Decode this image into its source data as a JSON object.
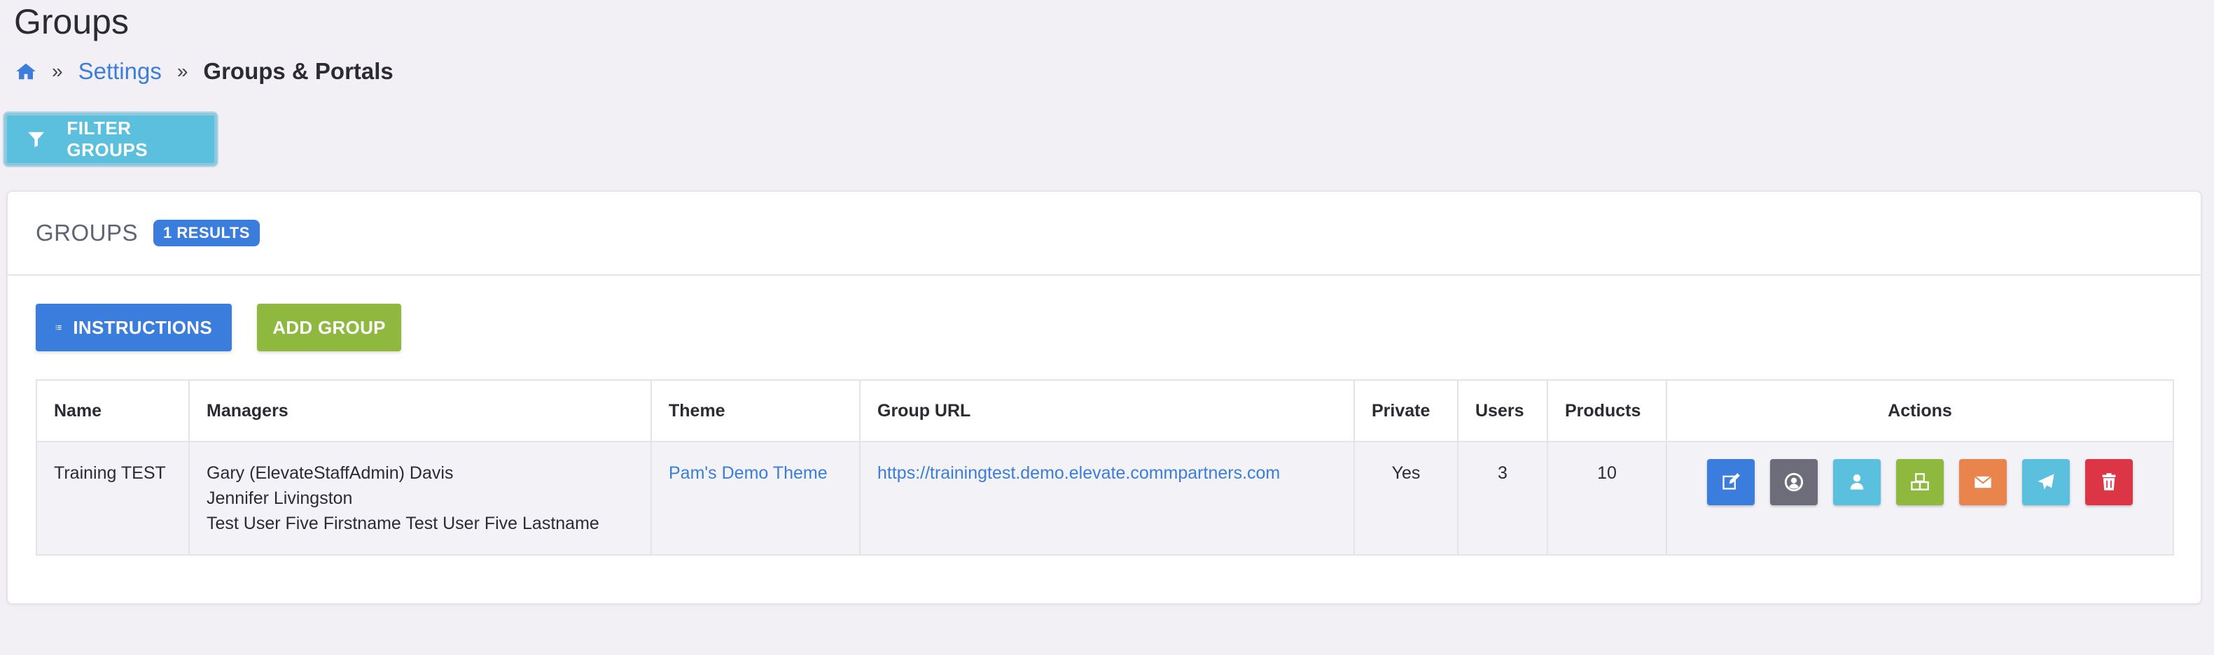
{
  "page": {
    "title": "Groups"
  },
  "breadcrumb": {
    "separator": "»",
    "settings": "Settings",
    "current": "Groups & Portals"
  },
  "filter_button": {
    "label": "FILTER GROUPS"
  },
  "card": {
    "title": "GROUPS",
    "badge": "1 RESULTS"
  },
  "buttons": {
    "instructions": "INSTRUCTIONS",
    "add_group": "ADD GROUP"
  },
  "table": {
    "headers": [
      "Name",
      "Managers",
      "Theme",
      "Group URL",
      "Private",
      "Users",
      "Products",
      "Actions"
    ],
    "rows": [
      {
        "name": "Training TEST",
        "managers": [
          "Gary (ElevateStaffAdmin) Davis",
          "Jennifer Livingston",
          "Test User Five Firstname Test User Five Lastname"
        ],
        "theme": "Pam's Demo Theme",
        "url": "https://trainingtest.demo.elevate.commpartners.com",
        "private": "Yes",
        "users": "3",
        "products": "10"
      }
    ]
  },
  "actions": [
    {
      "icon": "edit-icon",
      "color": "#3b7ddd"
    },
    {
      "icon": "user-circle-icon",
      "color": "#6c6c7a"
    },
    {
      "icon": "user-icon",
      "color": "#5bc0de"
    },
    {
      "icon": "cubes-icon",
      "color": "#8fb93e"
    },
    {
      "icon": "envelope-icon",
      "color": "#e8844c"
    },
    {
      "icon": "paper-plane-icon",
      "color": "#5bc0de"
    },
    {
      "icon": "trash-icon",
      "color": "#dc3545"
    }
  ]
}
